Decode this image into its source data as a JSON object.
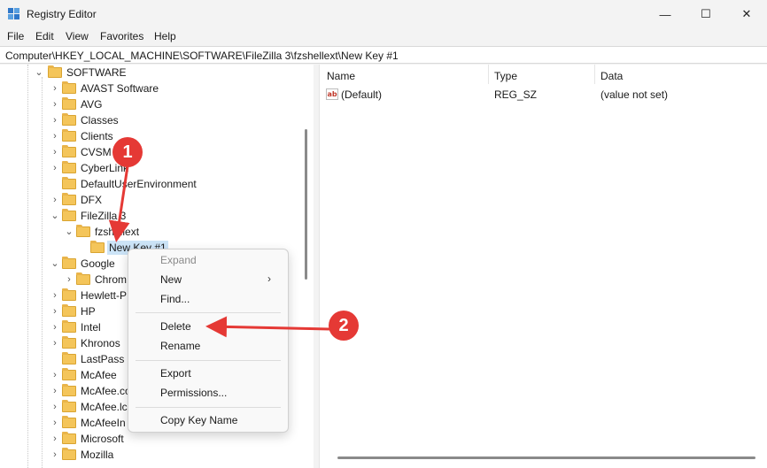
{
  "window": {
    "title": "Registry Editor",
    "minimize_glyph": "—",
    "maximize_glyph": "☐",
    "close_glyph": "✕"
  },
  "menu": [
    "File",
    "Edit",
    "View",
    "Favorites",
    "Help"
  ],
  "address": "Computer\\HKEY_LOCAL_MACHINE\\SOFTWARE\\FileZilla 3\\fzshellext\\New Key #1",
  "tree": {
    "software": "SOFTWARE",
    "items": [
      "AVAST Software",
      "AVG",
      "Classes",
      "Clients",
      "CVSM",
      "CyberLink",
      "DefaultUserEnvironment",
      "DFX",
      "FileZilla 3",
      "fzshellext",
      "New Key #1",
      "Google",
      "Chrom",
      "Hewlett-P",
      "HP",
      "Intel",
      "Khronos",
      "LastPass",
      "McAfee",
      "McAfee.co",
      "McAfee.lc",
      "McAfeeIn",
      "Microsoft",
      "Mozilla"
    ]
  },
  "values_pane": {
    "columns": [
      "Name",
      "Type",
      "Data"
    ],
    "rows": [
      {
        "name": "(Default)",
        "type": "REG_SZ",
        "data": "(value not set)",
        "icon": "ab-string-icon"
      }
    ]
  },
  "context_menu": {
    "items": [
      "Expand",
      "New",
      "Find...",
      "Delete",
      "Rename",
      "Export",
      "Permissions...",
      "Copy Key Name"
    ],
    "submenu_glyph": "›"
  },
  "annotations": {
    "badge1": "1",
    "badge2": "2",
    "color": "#e53935"
  }
}
